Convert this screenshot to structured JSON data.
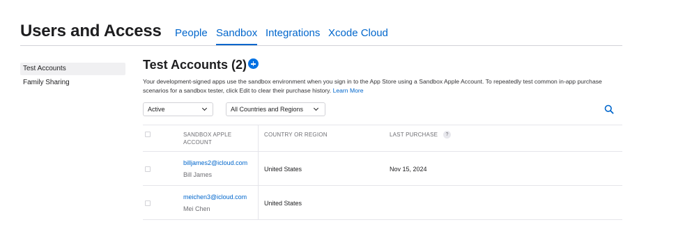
{
  "header": {
    "title": "Users and Access",
    "tabs": [
      {
        "label": "People",
        "active": false
      },
      {
        "label": "Sandbox",
        "active": true
      },
      {
        "label": "Integrations",
        "active": false
      },
      {
        "label": "Xcode Cloud",
        "active": false
      }
    ]
  },
  "sidebar": {
    "items": [
      {
        "label": "Test Accounts",
        "selected": true
      },
      {
        "label": "Family Sharing",
        "selected": false
      }
    ]
  },
  "main": {
    "title": "Test Accounts (2)",
    "add_icon": "plus-circle-icon",
    "description": "Your development-signed apps use the sandbox environment when you sign in to the App Store using a Sandbox Apple Account. To repeatedly test common in-app purchase scenarios for a sandbox tester, click Edit to clear their purchase history.",
    "learn_more": "Learn More",
    "filters": {
      "status": "Active",
      "country": "All Countries and Regions"
    },
    "search_icon": "search-icon",
    "table": {
      "headers": {
        "account": "SANDBOX APPLE ACCOUNT",
        "country": "COUNTRY OR REGION",
        "last_purchase": "LAST PURCHASE",
        "help": "?"
      },
      "rows": [
        {
          "email": "billjames2@icloud.com",
          "name": "Bill James",
          "country": "United States",
          "last_purchase": "Nov 15, 2024"
        },
        {
          "email": "meichen3@icloud.com",
          "name": "Mei Chen",
          "country": "United States",
          "last_purchase": ""
        }
      ]
    }
  },
  "colors": {
    "accent": "#0066cc",
    "button_blue": "#0071e3",
    "divider": "#e5e5ea",
    "muted_text": "#6e6e73"
  }
}
